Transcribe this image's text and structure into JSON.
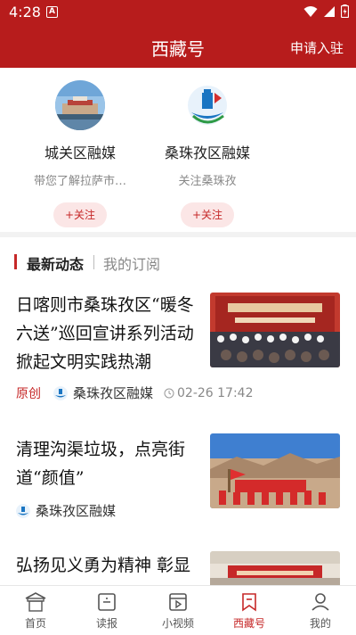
{
  "status_bar": {
    "time": "4:28",
    "notification_icon": "A"
  },
  "header": {
    "title": "西藏号",
    "apply_label": "申请入驻"
  },
  "accounts": [
    {
      "name": "城关区融媒",
      "desc": "带您了解拉萨市…",
      "follow_label": "+关注",
      "avatar": "palace-photo"
    },
    {
      "name": "桑珠孜区融媒",
      "desc": "关注桑珠孜",
      "follow_label": "+关注",
      "avatar": "media-logo"
    }
  ],
  "tabs": {
    "latest": "最新动态",
    "subscriptions": "我的订阅"
  },
  "news": [
    {
      "title": "日喀则市桑珠孜区“暖冬六送”巡回宣讲系列活动掀起文明实践热潮",
      "tag": "原创",
      "source": "桑珠孜区融媒",
      "time": "02-26  17:42"
    },
    {
      "title": "清理沟渠垃圾，点亮街道“颜值”",
      "source": "桑珠孜区融媒"
    },
    {
      "title": "弘扬见义勇为精神 彰显社会正能量"
    }
  ],
  "bottom_nav": [
    {
      "label": "首页",
      "icon": "home-icon"
    },
    {
      "label": "读报",
      "icon": "newspaper-icon"
    },
    {
      "label": "小视频",
      "icon": "video-icon"
    },
    {
      "label": "西藏号",
      "icon": "bookmark-icon",
      "active": true
    },
    {
      "label": "我的",
      "icon": "profile-icon"
    }
  ],
  "colors": {
    "brand": "#b71c1c",
    "accent": "#c62828"
  }
}
